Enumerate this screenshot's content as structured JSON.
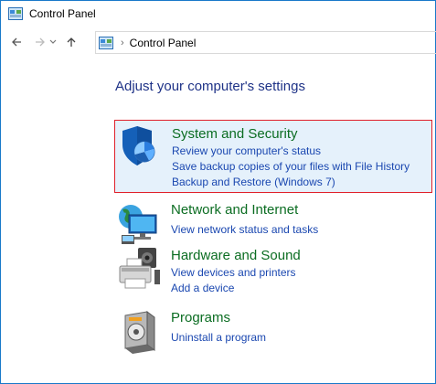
{
  "window": {
    "title": "Control Panel"
  },
  "address": {
    "back_icon": "back-arrow-icon",
    "forward_icon": "forward-arrow-icon",
    "recent_icon": "chevron-down-icon",
    "up_icon": "up-arrow-icon",
    "separator": "›",
    "crumb": "Control Panel"
  },
  "main": {
    "heading": "Adjust your computer's settings",
    "categories": [
      {
        "title": "System and Security",
        "icon": "shield-icon",
        "selected": true,
        "links": [
          "Review your computer's status",
          "Save backup copies of your files with File History",
          "Backup and Restore (Windows 7)"
        ]
      },
      {
        "title": "Network and Internet",
        "icon": "network-globe-icon",
        "selected": false,
        "links": [
          "View network status and tasks"
        ]
      },
      {
        "title": "Hardware and Sound",
        "icon": "printer-speaker-icon",
        "selected": false,
        "links": [
          "View devices and printers",
          "Add a device"
        ]
      },
      {
        "title": "Programs",
        "icon": "programs-box-icon",
        "selected": false,
        "links": [
          "Uninstall a program"
        ]
      }
    ]
  },
  "colors": {
    "window_border": "#1979ca",
    "category_title": "#0b6d22",
    "link": "#1a47b0",
    "heading": "#1e3287",
    "selection_border": "#e0202a",
    "selection_bg": "#e5f1fb"
  }
}
